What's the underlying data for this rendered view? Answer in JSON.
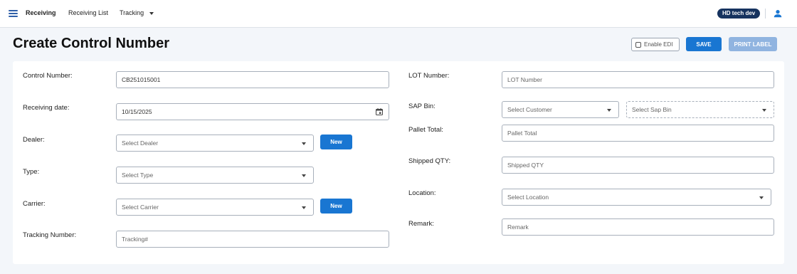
{
  "nav": {
    "items": [
      {
        "label": "Receiving",
        "active": true
      },
      {
        "label": "Receiving List",
        "active": false
      },
      {
        "label": "Tracking",
        "active": false,
        "has_dropdown": true
      }
    ],
    "user": "HD tech dev"
  },
  "page": {
    "title": "Create Control Number"
  },
  "actions": {
    "enable_edi": "Enable EDI",
    "enable_edi_checked": false,
    "save": "SAVE",
    "print_label": "PRINT LABEL"
  },
  "form": {
    "control_number": {
      "label": "Control Number:",
      "value": "CB251015001"
    },
    "receiving_date": {
      "label": "Receiving date:",
      "value": "10/15/2025"
    },
    "dealer": {
      "label": "Dealer:",
      "placeholder": "Select Dealer",
      "new_label": "New"
    },
    "type": {
      "label": "Type:",
      "placeholder": "Select Type"
    },
    "carrier": {
      "label": "Carrier:",
      "placeholder": "Select Carrier",
      "new_label": "New"
    },
    "tracking_number": {
      "label": "Tracking Number:",
      "placeholder": "Tracking#"
    },
    "lot_number": {
      "label": "LOT Number:",
      "placeholder": "LOT Number"
    },
    "sap_bin": {
      "label": "SAP Bin:",
      "customer_placeholder": "Select Customer",
      "bin_placeholder": "Select Sap Bin"
    },
    "pallet_total": {
      "label": "Pallet Total:",
      "placeholder": "Pallet Total"
    },
    "shipped_qty": {
      "label": "Shipped QTY:",
      "placeholder": "Shipped QTY"
    },
    "location": {
      "label": "Location:",
      "placeholder": "Select Location"
    },
    "remark": {
      "label": "Remark:",
      "placeholder": "Remark"
    }
  },
  "colors": {
    "primary": "#1976d2",
    "primary_disabled": "#90b4e0",
    "badge": "#16335f",
    "background": "#f3f6fa"
  }
}
